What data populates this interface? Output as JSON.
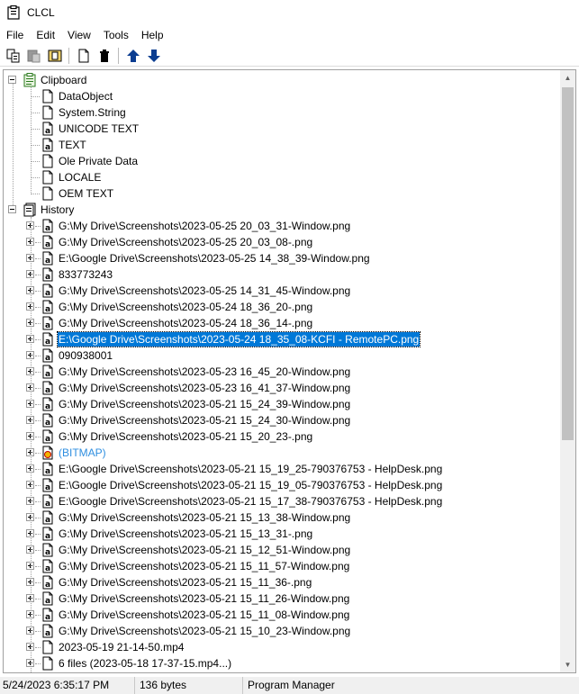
{
  "window": {
    "title": "CLCL"
  },
  "menu": [
    "File",
    "Edit",
    "View",
    "Tools",
    "Help"
  ],
  "toolbar": {
    "buttons": [
      {
        "name": "copy-icon"
      },
      {
        "name": "paste-icon"
      },
      {
        "name": "clipboard-view-icon"
      },
      {
        "name": "new-document-icon"
      },
      {
        "name": "delete-icon"
      },
      {
        "name": "move-up-icon"
      },
      {
        "name": "move-down-icon"
      }
    ]
  },
  "tree": {
    "clipboard": {
      "label": "Clipboard",
      "formats": [
        "DataObject",
        "System.String",
        "UNICODE TEXT",
        "TEXT",
        "Ole Private Data",
        "LOCALE",
        "OEM TEXT"
      ],
      "format_icons": [
        "blank",
        "blank",
        "text",
        "text",
        "blank",
        "blank",
        "blank"
      ]
    },
    "history": {
      "label": "History",
      "items": [
        {
          "text": "G:\\My Drive\\Screenshots\\2023-05-25 20_03_31-Window.png"
        },
        {
          "text": "G:\\My Drive\\Screenshots\\2023-05-25 20_03_08-.png"
        },
        {
          "text": "E:\\Google Drive\\Screenshots\\2023-05-25 14_38_39-Window.png"
        },
        {
          "text": "833773243"
        },
        {
          "text": "G:\\My Drive\\Screenshots\\2023-05-25 14_31_45-Window.png"
        },
        {
          "text": "G:\\My Drive\\Screenshots\\2023-05-24 18_36_20-.png"
        },
        {
          "text": "G:\\My Drive\\Screenshots\\2023-05-24 18_36_14-.png"
        },
        {
          "text": "E:\\Google Drive\\Screenshots\\2023-05-24 18_35_08-KCFI - RemotePC.png",
          "selected": true
        },
        {
          "text": "090938001"
        },
        {
          "text": "G:\\My Drive\\Screenshots\\2023-05-23 16_45_20-Window.png"
        },
        {
          "text": "G:\\My Drive\\Screenshots\\2023-05-23 16_41_37-Window.png"
        },
        {
          "text": "G:\\My Drive\\Screenshots\\2023-05-21 15_24_39-Window.png"
        },
        {
          "text": "G:\\My Drive\\Screenshots\\2023-05-21 15_24_30-Window.png"
        },
        {
          "text": "G:\\My Drive\\Screenshots\\2023-05-21 15_20_23-.png"
        },
        {
          "text": "(BITMAP)",
          "bitmap": true
        },
        {
          "text": "E:\\Google Drive\\Screenshots\\2023-05-21 15_19_25-790376753 - HelpDesk.png"
        },
        {
          "text": "E:\\Google Drive\\Screenshots\\2023-05-21 15_19_05-790376753 - HelpDesk.png"
        },
        {
          "text": "E:\\Google Drive\\Screenshots\\2023-05-21 15_17_38-790376753 - HelpDesk.png"
        },
        {
          "text": "G:\\My Drive\\Screenshots\\2023-05-21 15_13_38-Window.png"
        },
        {
          "text": "G:\\My Drive\\Screenshots\\2023-05-21 15_13_31-.png"
        },
        {
          "text": "G:\\My Drive\\Screenshots\\2023-05-21 15_12_51-Window.png"
        },
        {
          "text": "G:\\My Drive\\Screenshots\\2023-05-21 15_11_57-Window.png"
        },
        {
          "text": "G:\\My Drive\\Screenshots\\2023-05-21 15_11_36-.png"
        },
        {
          "text": "G:\\My Drive\\Screenshots\\2023-05-21 15_11_26-Window.png"
        },
        {
          "text": "G:\\My Drive\\Screenshots\\2023-05-21 15_11_08-Window.png"
        },
        {
          "text": "G:\\My Drive\\Screenshots\\2023-05-21 15_10_23-Window.png"
        },
        {
          "text": "2023-05-19 21-14-50.mp4",
          "blank_icon": true
        },
        {
          "text": "6 files (2023-05-18 17-37-15.mp4...)",
          "blank_icon": true
        }
      ]
    }
  },
  "status": {
    "datetime": "5/24/2023 6:35:17 PM",
    "size": "136 bytes",
    "window": "Program Manager"
  },
  "colors": {
    "selection": "#0078d7",
    "bitmap_text": "#2e8ee0",
    "toolbar_arrow": "#0b3d91"
  }
}
